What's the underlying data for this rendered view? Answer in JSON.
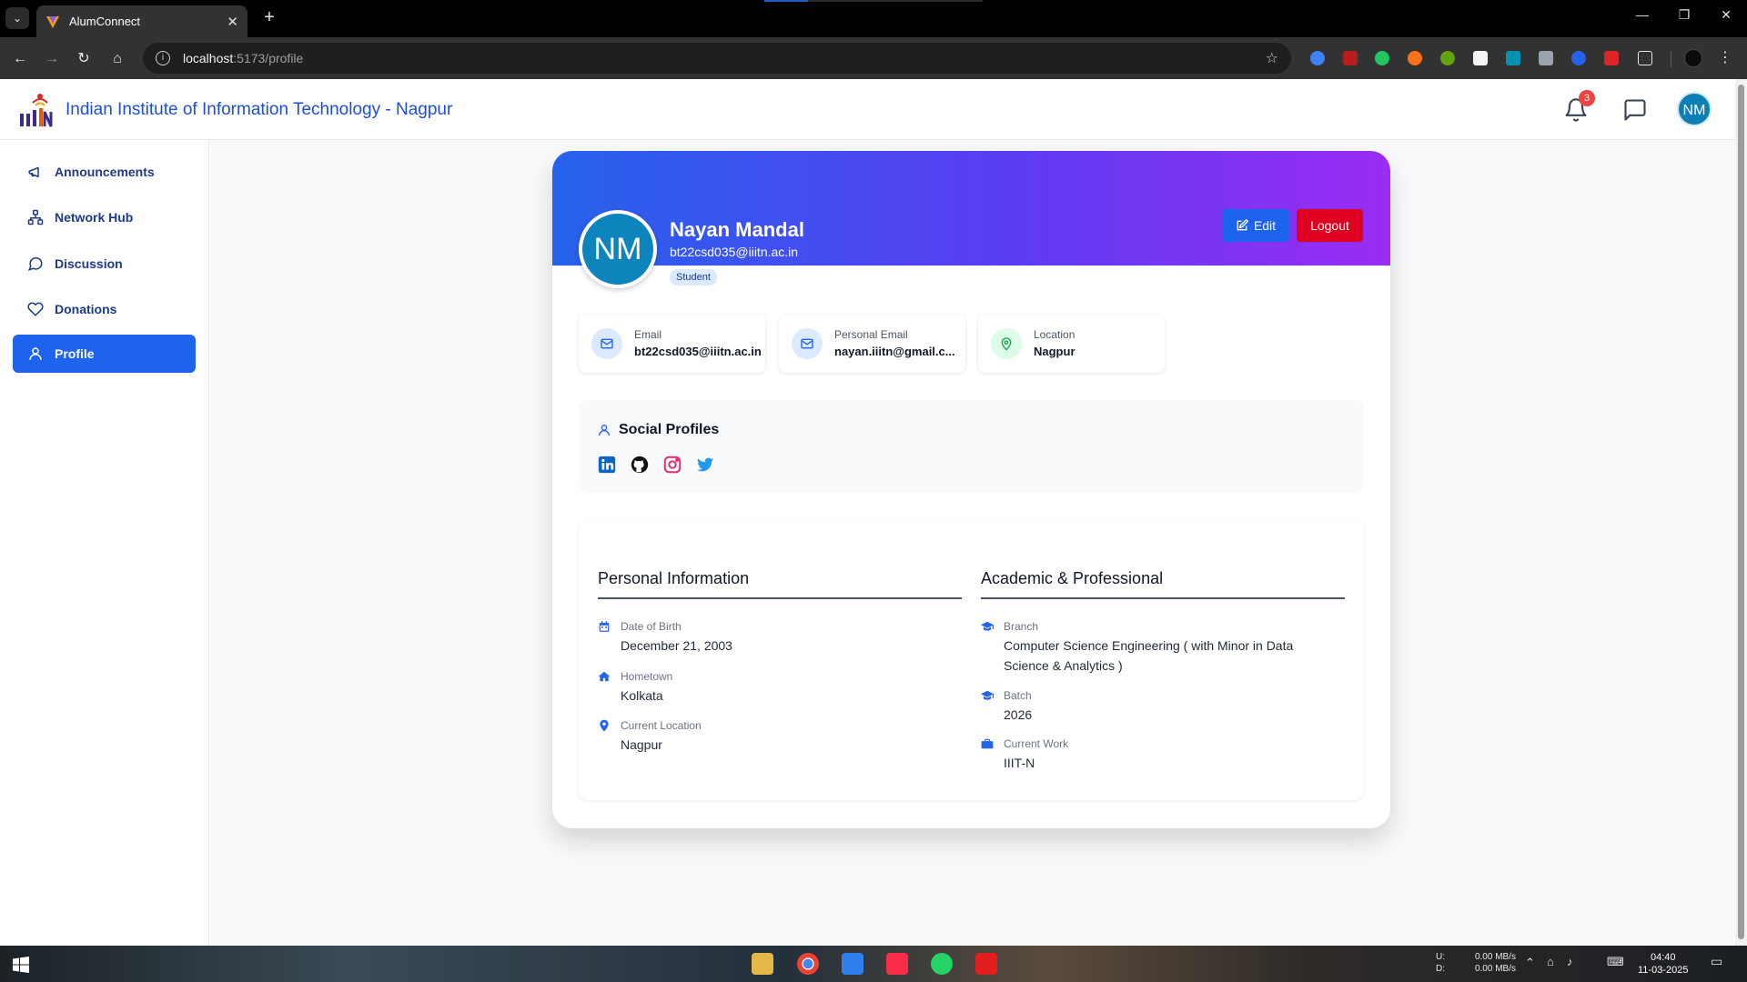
{
  "browser": {
    "tab_title": "AlumConnect",
    "tab_close": "✕",
    "new_tab": "+",
    "url_host": "localhost",
    "url_path": ":5173/profile",
    "window_controls": [
      "—",
      "❐",
      "✕"
    ]
  },
  "header": {
    "brand": "Indian Institute of Information Technology - Nagpur",
    "notification_count": "3",
    "avatar_initials": "NM"
  },
  "sidebar": {
    "items": [
      {
        "label": "Announcements",
        "icon": "megaphone-icon"
      },
      {
        "label": "Network Hub",
        "icon": "network-icon"
      },
      {
        "label": "Discussion",
        "icon": "chat-bubble-icon"
      },
      {
        "label": "Donations",
        "icon": "heart-icon"
      },
      {
        "label": "Profile",
        "icon": "user-icon",
        "active": true
      }
    ]
  },
  "profile": {
    "initials": "NM",
    "name": "Nayan Mandal",
    "email": "bt22csd035@iiitn.ac.in",
    "role": "Student",
    "edit_label": "Edit",
    "logout_label": "Logout"
  },
  "contacts": [
    {
      "label": "Email",
      "value": "bt22csd035@iiitn.ac.in",
      "icon": "mail-icon"
    },
    {
      "label": "Personal Email",
      "value": "nayan.iiitn@gmail.c...",
      "icon": "mail-icon"
    },
    {
      "label": "Location",
      "value": "Nagpur",
      "icon": "map-pin-icon"
    }
  ],
  "social": {
    "title": "Social Profiles",
    "links": [
      "linkedin-icon",
      "github-icon",
      "instagram-icon",
      "twitter-icon"
    ]
  },
  "personal": {
    "title": "Personal Information",
    "rows": [
      {
        "label": "Date of Birth",
        "value": "December 21, 2003"
      },
      {
        "label": "Hometown",
        "value": "Kolkata"
      },
      {
        "label": "Current Location",
        "value": "Nagpur"
      }
    ]
  },
  "academic": {
    "title": "Academic & Professional",
    "rows": [
      {
        "label": "Branch",
        "value": "Computer Science Engineering ( with Minor in Data Science & Analytics )"
      },
      {
        "label": "Batch",
        "value": "2026"
      },
      {
        "label": "Current Work",
        "value": "IIIT-N"
      }
    ]
  },
  "taskbar": {
    "net_up": "U:",
    "net_down": "D:",
    "up_rate": "0.00 MB/s",
    "down_rate": "0.00 MB/s",
    "time": "04:40",
    "date": "11-03-2025"
  },
  "colors": {
    "primary": "#1d63ed",
    "logout": "#e0001f",
    "banner_start": "#2563eb",
    "banner_end": "#9b2cf3"
  }
}
